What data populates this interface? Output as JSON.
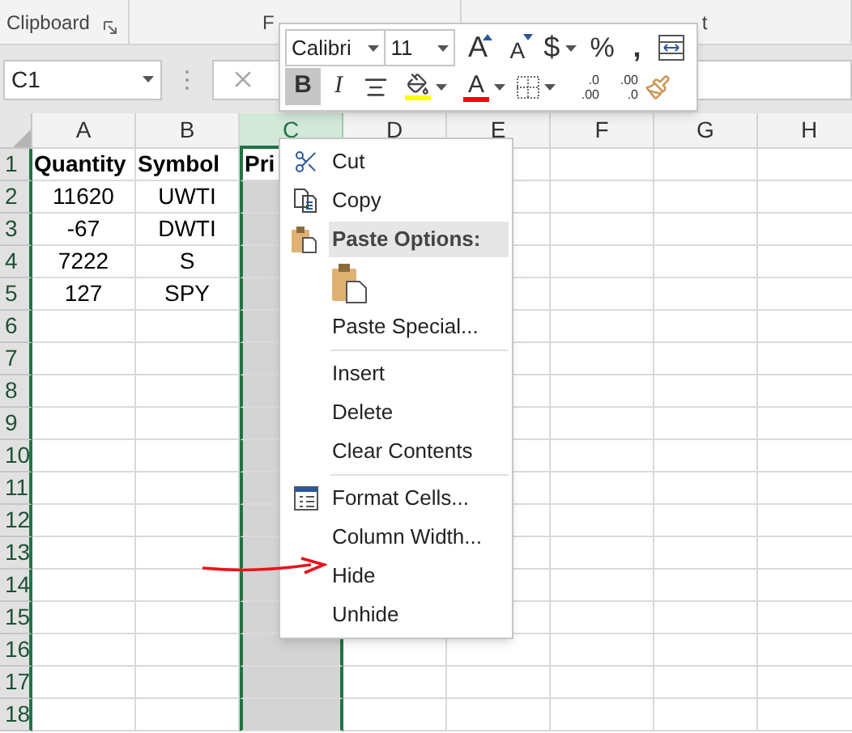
{
  "ribbon": {
    "groups": [
      {
        "label": "Clipboard"
      },
      {
        "label": "F"
      },
      {
        "label": "t"
      }
    ]
  },
  "formula_bar": {
    "name_box": "C1"
  },
  "mini_toolbar": {
    "font": "Calibri",
    "size": "11",
    "row1": [
      {
        "kind": "grow",
        "text": "A"
      },
      {
        "kind": "shrink",
        "text": "A"
      },
      {
        "kind": "currency",
        "text": "$"
      },
      {
        "kind": "percent",
        "text": "%"
      },
      {
        "kind": "comma",
        "text": ","
      },
      {
        "kind": "wrap"
      }
    ],
    "row2": [
      {
        "kind": "bold",
        "text": "B",
        "on": true
      },
      {
        "kind": "italic",
        "text": "I",
        "on": false
      },
      {
        "kind": "align"
      },
      {
        "kind": "fill",
        "color": "#ffff00"
      },
      {
        "kind": "font_color",
        "text": "A",
        "color": "#ff0000"
      },
      {
        "kind": "borders"
      },
      {
        "kind": "increase_decimal",
        "top": ".0",
        "bottom": ".00"
      },
      {
        "kind": "decrease_decimal",
        "top": ".00",
        "bottom": ".0"
      },
      {
        "kind": "painter"
      }
    ]
  },
  "sheet": {
    "columns": [
      {
        "label": "A",
        "selected": false
      },
      {
        "label": "B",
        "selected": false
      },
      {
        "label": "C",
        "selected": true
      },
      {
        "label": "D",
        "selected": false
      },
      {
        "label": "E",
        "selected": false
      },
      {
        "label": "F",
        "selected": false
      },
      {
        "label": "G",
        "selected": false
      },
      {
        "label": "H",
        "selected": false
      }
    ],
    "rows": [
      {
        "label": "1",
        "header": true,
        "active": true,
        "cells": [
          "Quantity",
          "Symbol",
          "Pri"
        ]
      },
      {
        "label": "2",
        "header": false,
        "active": false,
        "cells": [
          "11620",
          "UWTI"
        ]
      },
      {
        "label": "3",
        "header": false,
        "active": false,
        "cells": [
          "-67",
          "DWTI"
        ]
      },
      {
        "label": "4",
        "header": false,
        "active": false,
        "cells": [
          "7222",
          "S"
        ]
      },
      {
        "label": "5",
        "header": false,
        "active": false,
        "cells": [
          "127",
          "SPY"
        ]
      },
      {
        "label": "6",
        "active": false
      },
      {
        "label": "7",
        "active": false
      },
      {
        "label": "8",
        "active": false
      },
      {
        "label": "9",
        "active": false
      },
      {
        "label": "10",
        "active": false
      },
      {
        "label": "11",
        "active": false
      },
      {
        "label": "12",
        "active": false
      },
      {
        "label": "13",
        "active": false
      },
      {
        "label": "14",
        "active": false
      },
      {
        "label": "15",
        "active": false
      },
      {
        "label": "16",
        "active": false
      },
      {
        "label": "17",
        "active": false
      },
      {
        "label": "18",
        "active": false
      }
    ]
  },
  "context_menu": {
    "items": [
      {
        "kind": "cut",
        "label": "Cut"
      },
      {
        "kind": "copy",
        "label": "Copy"
      },
      {
        "kind": "paste_header",
        "label": "Paste Options:"
      },
      {
        "kind": "paste_icons"
      },
      {
        "kind": "item",
        "label": "Paste Special..."
      },
      {
        "kind": "separator"
      },
      {
        "kind": "item",
        "label": "Insert"
      },
      {
        "kind": "item",
        "label": "Delete"
      },
      {
        "kind": "item",
        "label": "Clear Contents"
      },
      {
        "kind": "separator"
      },
      {
        "kind": "format",
        "label": "Format Cells..."
      },
      {
        "kind": "item",
        "label": "Column Width..."
      },
      {
        "kind": "item",
        "label": "Hide"
      },
      {
        "kind": "item",
        "label": "Unhide"
      }
    ]
  }
}
